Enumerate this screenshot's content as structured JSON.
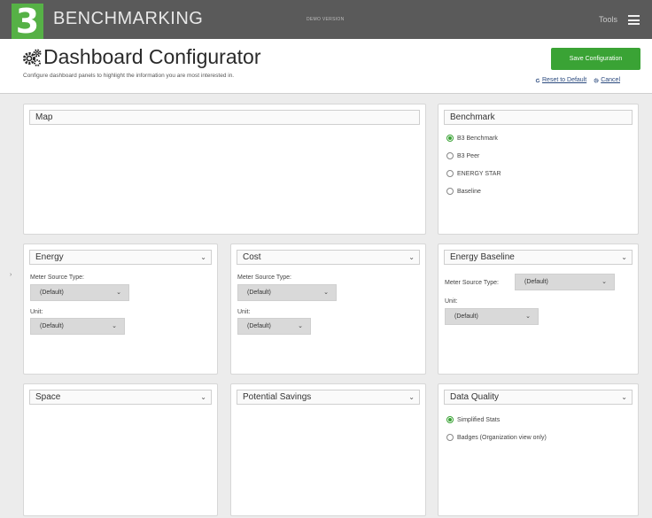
{
  "topbar": {
    "logo_char": "3",
    "brand": "BENCHMARKING",
    "demo_label": "DEMO VERSION",
    "tools_label": "Tools",
    "menu_icon": "hamburger-icon"
  },
  "header": {
    "title": "Dashboard Configurator",
    "title_icon": "gears-icon",
    "subtitle": "Configure dashboard panels to highlight the information you are most interested in.",
    "save_label": "Save Configuration",
    "reset_label": "Reset to Default",
    "cancel_label": "Cancel"
  },
  "colors": {
    "accent": "#3aa335",
    "logo": "#56b146",
    "topbar": "#5a5a5a",
    "link": "#2b4a7e"
  },
  "panels": {
    "map": {
      "title": "Map"
    },
    "benchmark": {
      "title": "Benchmark",
      "options": [
        "B3 Benchmark",
        "B3 Peer",
        "ENERGY STAR",
        "Baseline"
      ],
      "selected": "B3 Benchmark"
    },
    "energy": {
      "title": "Energy",
      "meter_label": "Meter Source Type:",
      "meter_value": "(Default)",
      "unit_label": "Unit:",
      "unit_value": "(Default)"
    },
    "cost": {
      "title": "Cost",
      "meter_label": "Meter Source Type:",
      "meter_value": "(Default)",
      "unit_label": "Unit:",
      "unit_value": "(Default)"
    },
    "energy_baseline": {
      "title": "Energy Baseline",
      "meter_label": "Meter Source Type:",
      "meter_value": "(Default)",
      "unit_label": "Unit:",
      "unit_value": "(Default)"
    },
    "space": {
      "title": "Space"
    },
    "potential_savings": {
      "title": "Potential Savings"
    },
    "data_quality": {
      "title": "Data Quality",
      "options": [
        "Simplified Stats",
        "Badges (Organization view only)"
      ],
      "selected": "Simplified Stats"
    }
  }
}
